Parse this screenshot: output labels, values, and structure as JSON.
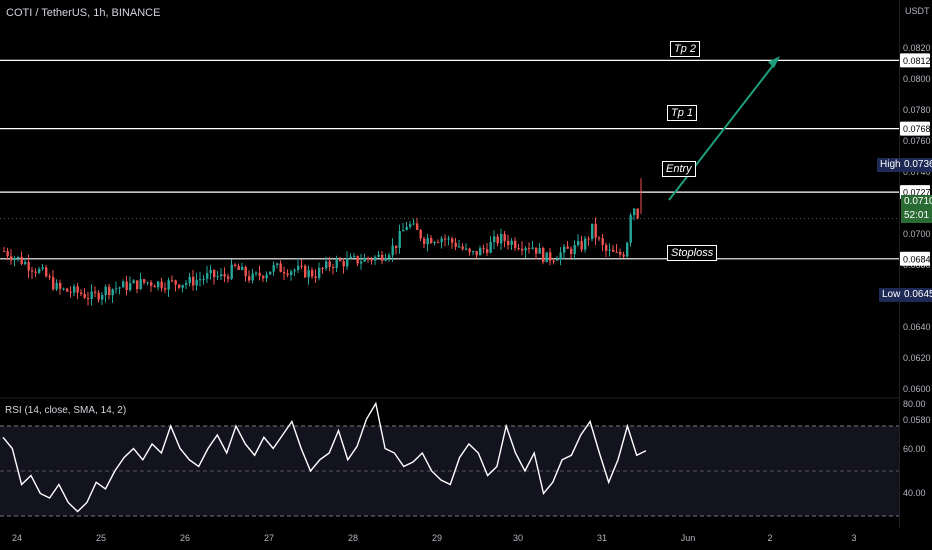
{
  "header": {
    "symbol": "COTI / TetherUS, 1h, BINANCE",
    "currency": "USDT"
  },
  "levels": [
    {
      "label": "Tp 2",
      "price": 0.0812,
      "price_text": "0.0812"
    },
    {
      "label": "Tp 1",
      "price": 0.0768,
      "price_text": "0.0768"
    },
    {
      "label": "Entry",
      "price": 0.0727,
      "price_text": "0.0727"
    },
    {
      "label": "Stoploss",
      "price": 0.0684,
      "price_text": "0.0684"
    }
  ],
  "markers": {
    "high_label": "High",
    "high_value": "0.0736",
    "low_label": "Low",
    "low_value": "0.0645",
    "last_price": "0.0710",
    "countdown": "52:01"
  },
  "colors": {
    "up": "#26a69a",
    "down": "#ef5350",
    "level_line": "#ffffff",
    "arrow": "#1e9e7c",
    "rsi_line": "#ffffff",
    "rsi_band": "#131320"
  },
  "rsi": {
    "title": "RSI (14, close, SMA, 14, 2)",
    "ticks": [
      "80.00",
      "60.00",
      "40.00"
    ]
  },
  "chart_data": {
    "type": "candlestick",
    "price_axis": {
      "ticks": [
        "0.0820",
        "0.0800",
        "0.0780",
        "0.0760",
        "0.0740",
        "0.0720",
        "0.0700",
        "0.0680",
        "0.0660",
        "0.0640",
        "0.0620",
        "0.0600",
        "0.0580"
      ],
      "range": [
        0.057,
        0.084
      ]
    },
    "x_ticks": [
      "24",
      "25",
      "26",
      "27",
      "28",
      "29",
      "30",
      "31",
      "Jun",
      "2",
      "3"
    ],
    "close_path": [
      [
        24.0,
        0.0689
      ],
      [
        24.2,
        0.0683
      ],
      [
        24.45,
        0.0675
      ],
      [
        24.65,
        0.0664
      ],
      [
        24.9,
        0.0662
      ],
      [
        25.05,
        0.0659
      ],
      [
        25.2,
        0.0664
      ],
      [
        25.4,
        0.0666
      ],
      [
        25.7,
        0.0669
      ],
      [
        25.9,
        0.0668
      ],
      [
        26.2,
        0.0669
      ],
      [
        26.45,
        0.0673
      ],
      [
        26.6,
        0.0672
      ],
      [
        26.75,
        0.0678
      ],
      [
        26.95,
        0.0671
      ],
      [
        27.2,
        0.0678
      ],
      [
        27.45,
        0.0677
      ],
      [
        27.7,
        0.0674
      ],
      [
        27.9,
        0.0681
      ],
      [
        28.2,
        0.0683
      ],
      [
        28.45,
        0.0685
      ],
      [
        28.65,
        0.0692
      ],
      [
        28.8,
        0.0707
      ],
      [
        29.0,
        0.0697
      ],
      [
        29.2,
        0.0698
      ],
      [
        29.4,
        0.0693
      ],
      [
        29.55,
        0.0686
      ],
      [
        29.7,
        0.069
      ],
      [
        29.9,
        0.0697
      ],
      [
        30.1,
        0.0694
      ],
      [
        30.3,
        0.0692
      ],
      [
        30.45,
        0.0684
      ],
      [
        30.7,
        0.0689
      ],
      [
        30.9,
        0.0693
      ],
      [
        31.0,
        0.0703
      ],
      [
        31.15,
        0.0689
      ],
      [
        31.3,
        0.0686
      ],
      [
        31.4,
        0.0689
      ],
      [
        31.47,
        0.072
      ],
      [
        31.52,
        0.0716
      ],
      [
        31.56,
        0.071
      ]
    ],
    "rsi_values": [
      65,
      60,
      44,
      48,
      40,
      38,
      44,
      36,
      32,
      36,
      45,
      42,
      50,
      56,
      60,
      55,
      62,
      58,
      70,
      60,
      55,
      52,
      60,
      66,
      58,
      70,
      62,
      57,
      65,
      60,
      66,
      72,
      60,
      50,
      55,
      58,
      68,
      55,
      61,
      73,
      80,
      60,
      58,
      52,
      54,
      58,
      50,
      46,
      44,
      56,
      62,
      58,
      48,
      52,
      70,
      58,
      50,
      58,
      40,
      45,
      55,
      57,
      66,
      72,
      58,
      45,
      55,
      70,
      57,
      59
    ]
  }
}
